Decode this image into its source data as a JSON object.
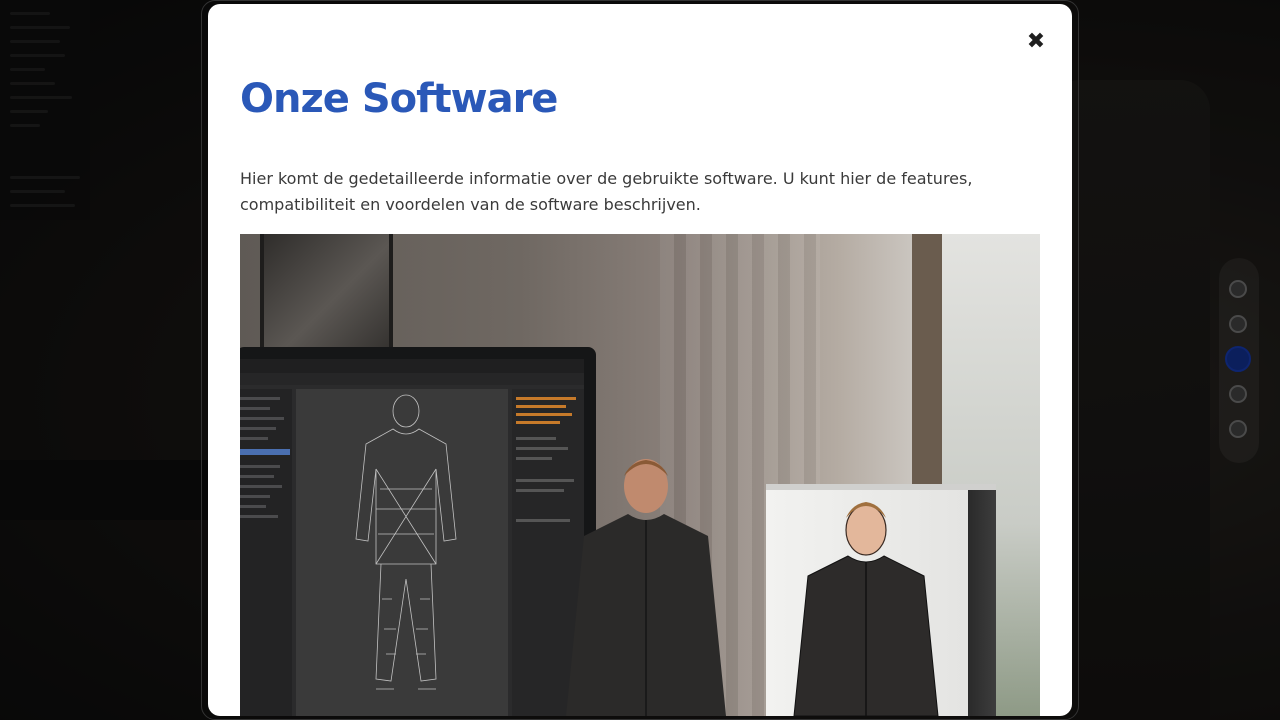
{
  "modal": {
    "close_icon": "close-icon",
    "close_glyph": "✖",
    "title": "Onze Software",
    "description": "Hier komt de gedetailleerde informatie over de gebruikte software. U kunt hier de features, compatibiliteit en voordelen van de software beschrijven.",
    "image": {
      "icon": "product-illustration"
    }
  },
  "side_nav": {
    "dots": [
      {
        "active": false
      },
      {
        "active": false
      },
      {
        "active": true
      },
      {
        "active": false
      },
      {
        "active": false
      }
    ]
  },
  "colors": {
    "title": "#2a58b8",
    "active_dot": "#0b1f5c",
    "modal_bg": "#ffffff",
    "overlay": "rgba(0,0,0,0.55)"
  }
}
